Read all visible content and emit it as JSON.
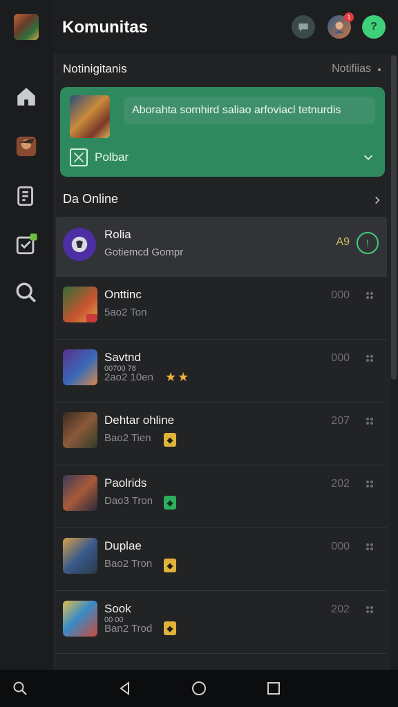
{
  "header": {
    "title": "Komunitas",
    "badge_count": "1",
    "help_label": "?"
  },
  "notifications": {
    "title": "Notinigitanis",
    "link": "Notifiias",
    "card": {
      "message": "Aborahta somhird saliao arfoviacl tetnurdis",
      "action_label": "Polbar"
    }
  },
  "online": {
    "title": "Da Online",
    "rows": [
      {
        "name": "Rolia",
        "sub": "Gotiemcd Gompr",
        "count": "A9"
      },
      {
        "name": "Onttinc",
        "sub": "5ao2 Ton",
        "count": "000"
      },
      {
        "name": "Savtnd",
        "sub2": "00700 78",
        "sub": "2ao2 10en",
        "count": "000",
        "stars": "★★"
      },
      {
        "name": "Dehtar ohline",
        "sub": "Bao2 Tien",
        "count": "207"
      },
      {
        "name": "Paolrids",
        "sub": "Dao3 Tron",
        "count": "202"
      },
      {
        "name": "Duplae",
        "sub": "Bao2 Tron",
        "count": "000"
      },
      {
        "name": "Sook",
        "sub2": "00 00",
        "sub": "Ban2 Trod",
        "count": "202"
      }
    ]
  },
  "colors": {
    "accent_green": "#2e8a5e",
    "online_ring": "#3fcf7a",
    "badge_red": "#e23b3b"
  }
}
